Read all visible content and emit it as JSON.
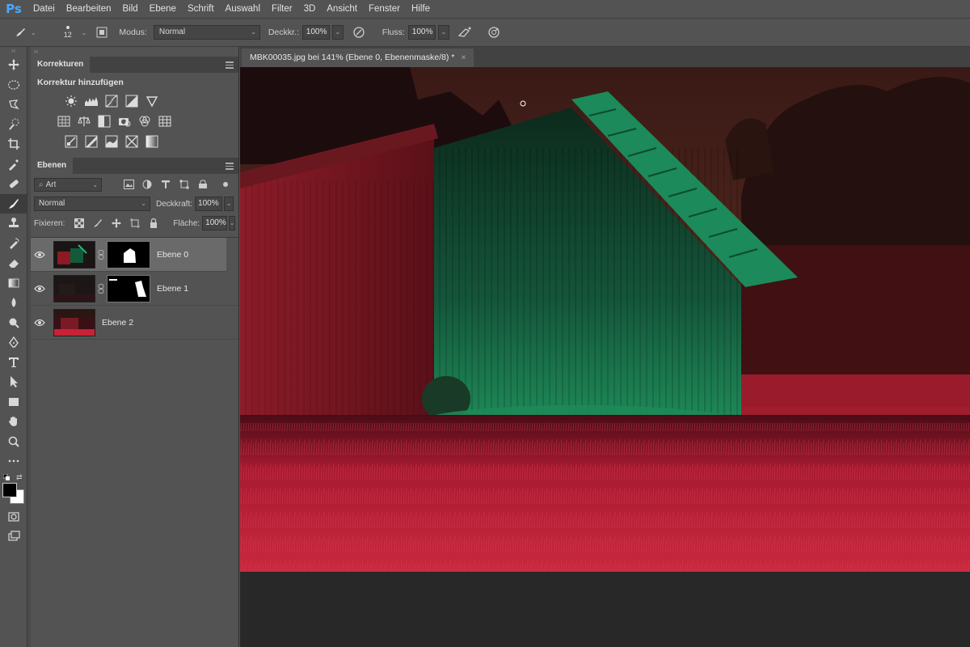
{
  "app": {
    "logo": "Ps"
  },
  "menu": [
    "Datei",
    "Bearbeiten",
    "Bild",
    "Ebene",
    "Schrift",
    "Auswahl",
    "Filter",
    "3D",
    "Ansicht",
    "Fenster",
    "Hilfe"
  ],
  "options": {
    "brush_size": "12",
    "mode_label": "Modus:",
    "mode_value": "Normal",
    "opacity_label": "Deckkr.:",
    "opacity_value": "100%",
    "flow_label": "Fluss:",
    "flow_value": "100%"
  },
  "corrections_panel": {
    "tab": "Korrekturen",
    "title": "Korrektur hinzufügen",
    "icons_row1": [
      "brightness-contrast-icon",
      "levels-icon",
      "curves-icon",
      "exposure-icon",
      "vibrance-icon"
    ],
    "icons_row2": [
      "hue-saturation-icon",
      "color-balance-icon",
      "black-white-icon",
      "photo-filter-icon",
      "channel-mixer-icon",
      "color-lookup-icon"
    ],
    "icons_row3": [
      "invert-icon",
      "posterize-icon",
      "threshold-icon",
      "selective-color-icon",
      "gradient-map-icon"
    ]
  },
  "layers_panel": {
    "tab": "Ebenen",
    "filter_value": "Art",
    "blend_mode": "Normal",
    "opacity_label": "Deckkraft:",
    "opacity_value": "100%",
    "lock_label": "Fixieren:",
    "fill_label": "Fläche:",
    "fill_value": "100%",
    "layers": [
      {
        "name": "Ebene 0",
        "selected": true,
        "has_mask": true
      },
      {
        "name": "Ebene 1",
        "selected": false,
        "has_mask": true
      },
      {
        "name": "Ebene 2",
        "selected": false,
        "has_mask": false
      }
    ]
  },
  "document": {
    "tab_title": "MBK00035.jpg bei 141% (Ebene 0, Ebenenmaske/8) *",
    "close_glyph": "×"
  },
  "colors": {
    "ui_bg": "#535353",
    "dark_bg": "#282828",
    "red_light": "#d2283c",
    "green_light": "#1e8c5a",
    "sky": "#5a2a22"
  }
}
